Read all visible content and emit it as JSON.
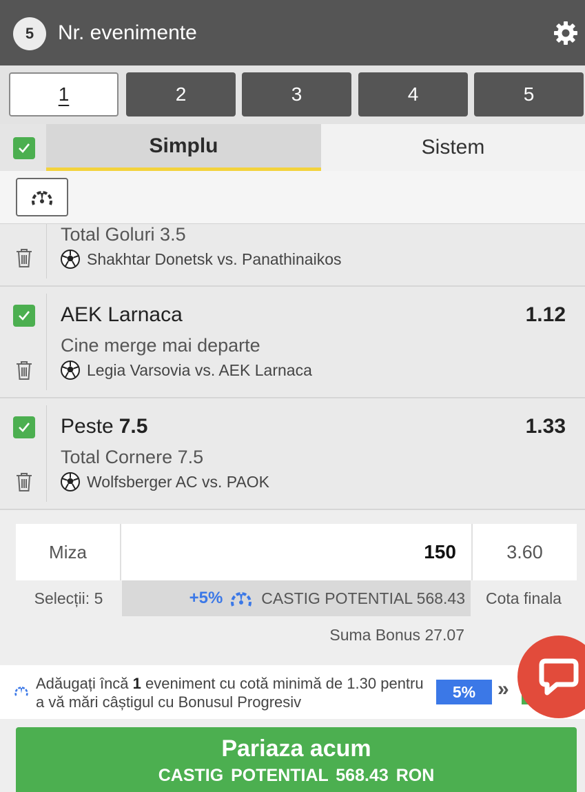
{
  "header": {
    "count": "5",
    "title": "Nr. evenimente",
    "icon": "gear-icon"
  },
  "slots": [
    "1",
    "2",
    "3",
    "4",
    "5"
  ],
  "tabs": {
    "simplu": "Simplu",
    "sistem": "Sistem"
  },
  "bets": [
    {
      "selection": "",
      "selection_value": "",
      "odds": "",
      "market": "Total Goluri 3.5",
      "match": "Shakhtar Donetsk vs. Panathinaikos"
    },
    {
      "selection": "AEK Larnaca",
      "selection_value": "",
      "odds": "1.12",
      "market": "Cine merge mai departe",
      "match": "Legia Varsovia vs. AEK Larnaca"
    },
    {
      "selection": "Peste",
      "selection_value": "7.5",
      "odds": "1.33",
      "market": "Total Cornere 7.5",
      "match": "Wolfsberger AC vs. PAOK"
    }
  ],
  "stake": {
    "label": "Miza",
    "value": "150",
    "total_odds": "3.60",
    "selections": "Selecții: 5",
    "bonus_percent": "+5%",
    "potential": "CASTIG POTENTIAL 568.43",
    "final_label": "Cota finala",
    "bonus_sum": "Suma Bonus 27.07"
  },
  "promo": {
    "text_before": "Adăugați încă ",
    "count": "1",
    "text_after": " eveniment cu cotă minimă de 1.30 pentru a vă mări câștigul cu Bonusul Progresiv",
    "badge": "5%",
    "arrows": "»"
  },
  "cta": {
    "title": "Pariaza acum",
    "subtitle": "CASTIG POTENTIAL  568.43 RON"
  },
  "colors": {
    "header": "#555555",
    "accent_green": "#4caf50",
    "accent_yellow": "#f3d23c",
    "bonus_blue": "#3b78e7",
    "chat_red": "#e24b3b"
  }
}
